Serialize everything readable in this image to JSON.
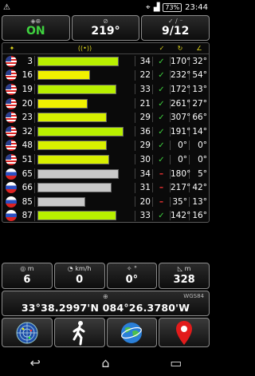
{
  "statusbar": {
    "battery": "73%",
    "time": "23:44"
  },
  "top": {
    "gps_status": "ON",
    "gps_icon": "satellite-target-icon",
    "heading": "219°",
    "heading_icon": "compass-icon",
    "sats": "9/12",
    "sats_icon": "checkmark-slash-icon"
  },
  "table": {
    "headers": {
      "sat": "satellite-icon",
      "signal": "signal-icon",
      "used": "check-icon",
      "elev": "refresh-icon",
      "azim": "angle-icon"
    },
    "rows": [
      {
        "flag": "us",
        "prn": "3",
        "snr": 34,
        "used": true,
        "az": "170°",
        "el": "32°",
        "color": "#b8f000"
      },
      {
        "flag": "us",
        "prn": "16",
        "snr": 22,
        "used": true,
        "az": "232°",
        "el": "54°",
        "color": "#f0f000"
      },
      {
        "flag": "us",
        "prn": "19",
        "snr": 33,
        "used": true,
        "az": "172°",
        "el": "13°",
        "color": "#b8f000"
      },
      {
        "flag": "us",
        "prn": "20",
        "snr": 21,
        "used": true,
        "az": "261°",
        "el": "27°",
        "color": "#f0f000"
      },
      {
        "flag": "us",
        "prn": "23",
        "snr": 29,
        "used": true,
        "az": "307°",
        "el": "66°",
        "color": "#d8f000"
      },
      {
        "flag": "us",
        "prn": "32",
        "snr": 36,
        "used": true,
        "az": "191°",
        "el": "14°",
        "color": "#b8f000"
      },
      {
        "flag": "us",
        "prn": "48",
        "snr": 29,
        "used": true,
        "az": "0°",
        "el": "0°",
        "color": "#d8f000"
      },
      {
        "flag": "us",
        "prn": "51",
        "snr": 30,
        "used": true,
        "az": "0°",
        "el": "0°",
        "color": "#d8f000"
      },
      {
        "flag": "ru",
        "prn": "65",
        "snr": 34,
        "used": false,
        "az": "180°",
        "el": "5°",
        "color": "#c8c8c8"
      },
      {
        "flag": "ru",
        "prn": "66",
        "snr": 31,
        "used": false,
        "az": "217°",
        "el": "42°",
        "color": "#c8c8c8"
      },
      {
        "flag": "ru",
        "prn": "85",
        "snr": 20,
        "used": false,
        "az": "35°",
        "el": "13°",
        "color": "#c8c8c8"
      },
      {
        "flag": "ru",
        "prn": "87",
        "snr": 33,
        "used": true,
        "az": "142°",
        "el": "16°",
        "color": "#b8f000"
      }
    ],
    "snr_max": 40
  },
  "info": {
    "accuracy_label": "m",
    "accuracy": "6",
    "speed_label": "km/h",
    "speed": "0",
    "bearing_label": "°",
    "bearing": "0°",
    "altitude_label": "m",
    "altitude": "328"
  },
  "coords": {
    "datum": "WGS84",
    "position": "33°38.2997'N   084°26.3780'W"
  },
  "tiles": [
    "radar-icon",
    "walking-man-icon",
    "globe-icon",
    "map-pin-icon"
  ],
  "nav": [
    "back-icon",
    "home-icon",
    "recents-icon"
  ]
}
